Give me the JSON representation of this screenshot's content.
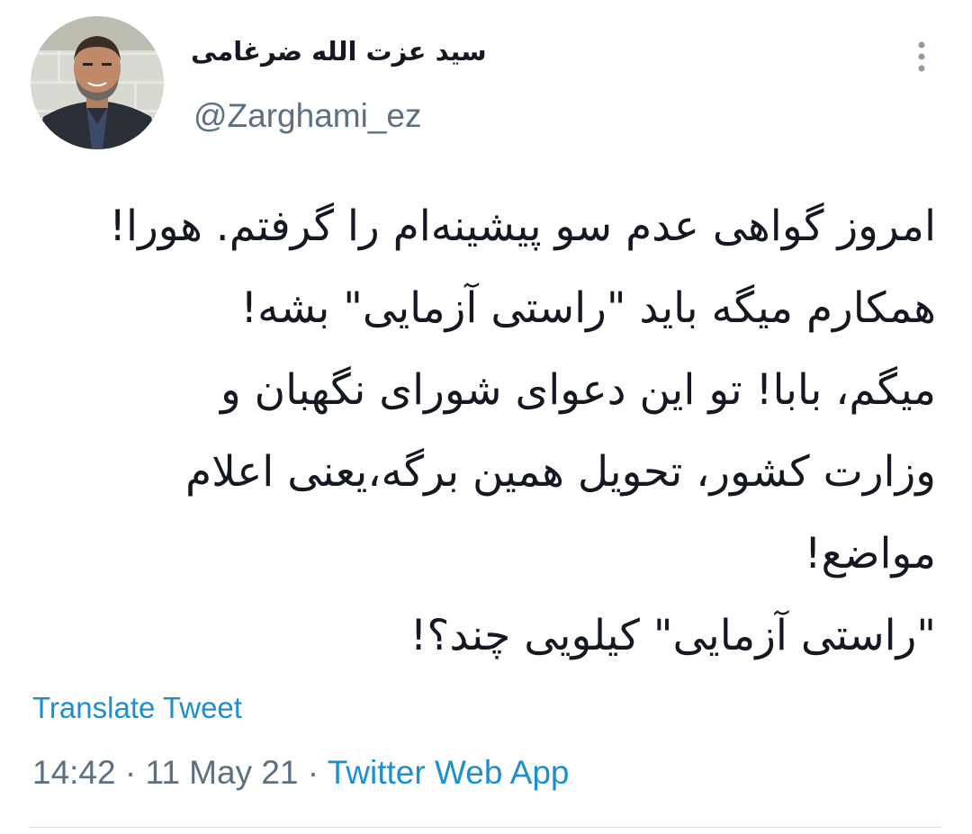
{
  "tweet": {
    "author": {
      "display_name": "سید عزت الله ضرغامی",
      "handle": "@Zarghami_ez"
    },
    "text_lines": [
      "امروز گواهی عدم سو پیشینه‌ام را گرفتم. هورا!",
      "همکارم میگه باید \"راستی آزمایی\" بشه!",
      "میگم، بابا! تو این دعوای شورای نگهبان و",
      "وزارت کشور، تحویل همین برگه،یعنی اعلام",
      "مواضع!",
      "\"راستی آزمایی\" کیلویی چند؟!"
    ],
    "translate_label": "Translate Tweet",
    "time": "14:42",
    "date": "11 May 21",
    "separator": "·",
    "source": "Twitter Web App"
  },
  "icons": {
    "more": "more-vertical-icon",
    "avatar": "avatar"
  },
  "colors": {
    "text": "#141823",
    "secondary": "#5b7083",
    "link": "#1d8fd1",
    "divider": "#d9dee3"
  }
}
